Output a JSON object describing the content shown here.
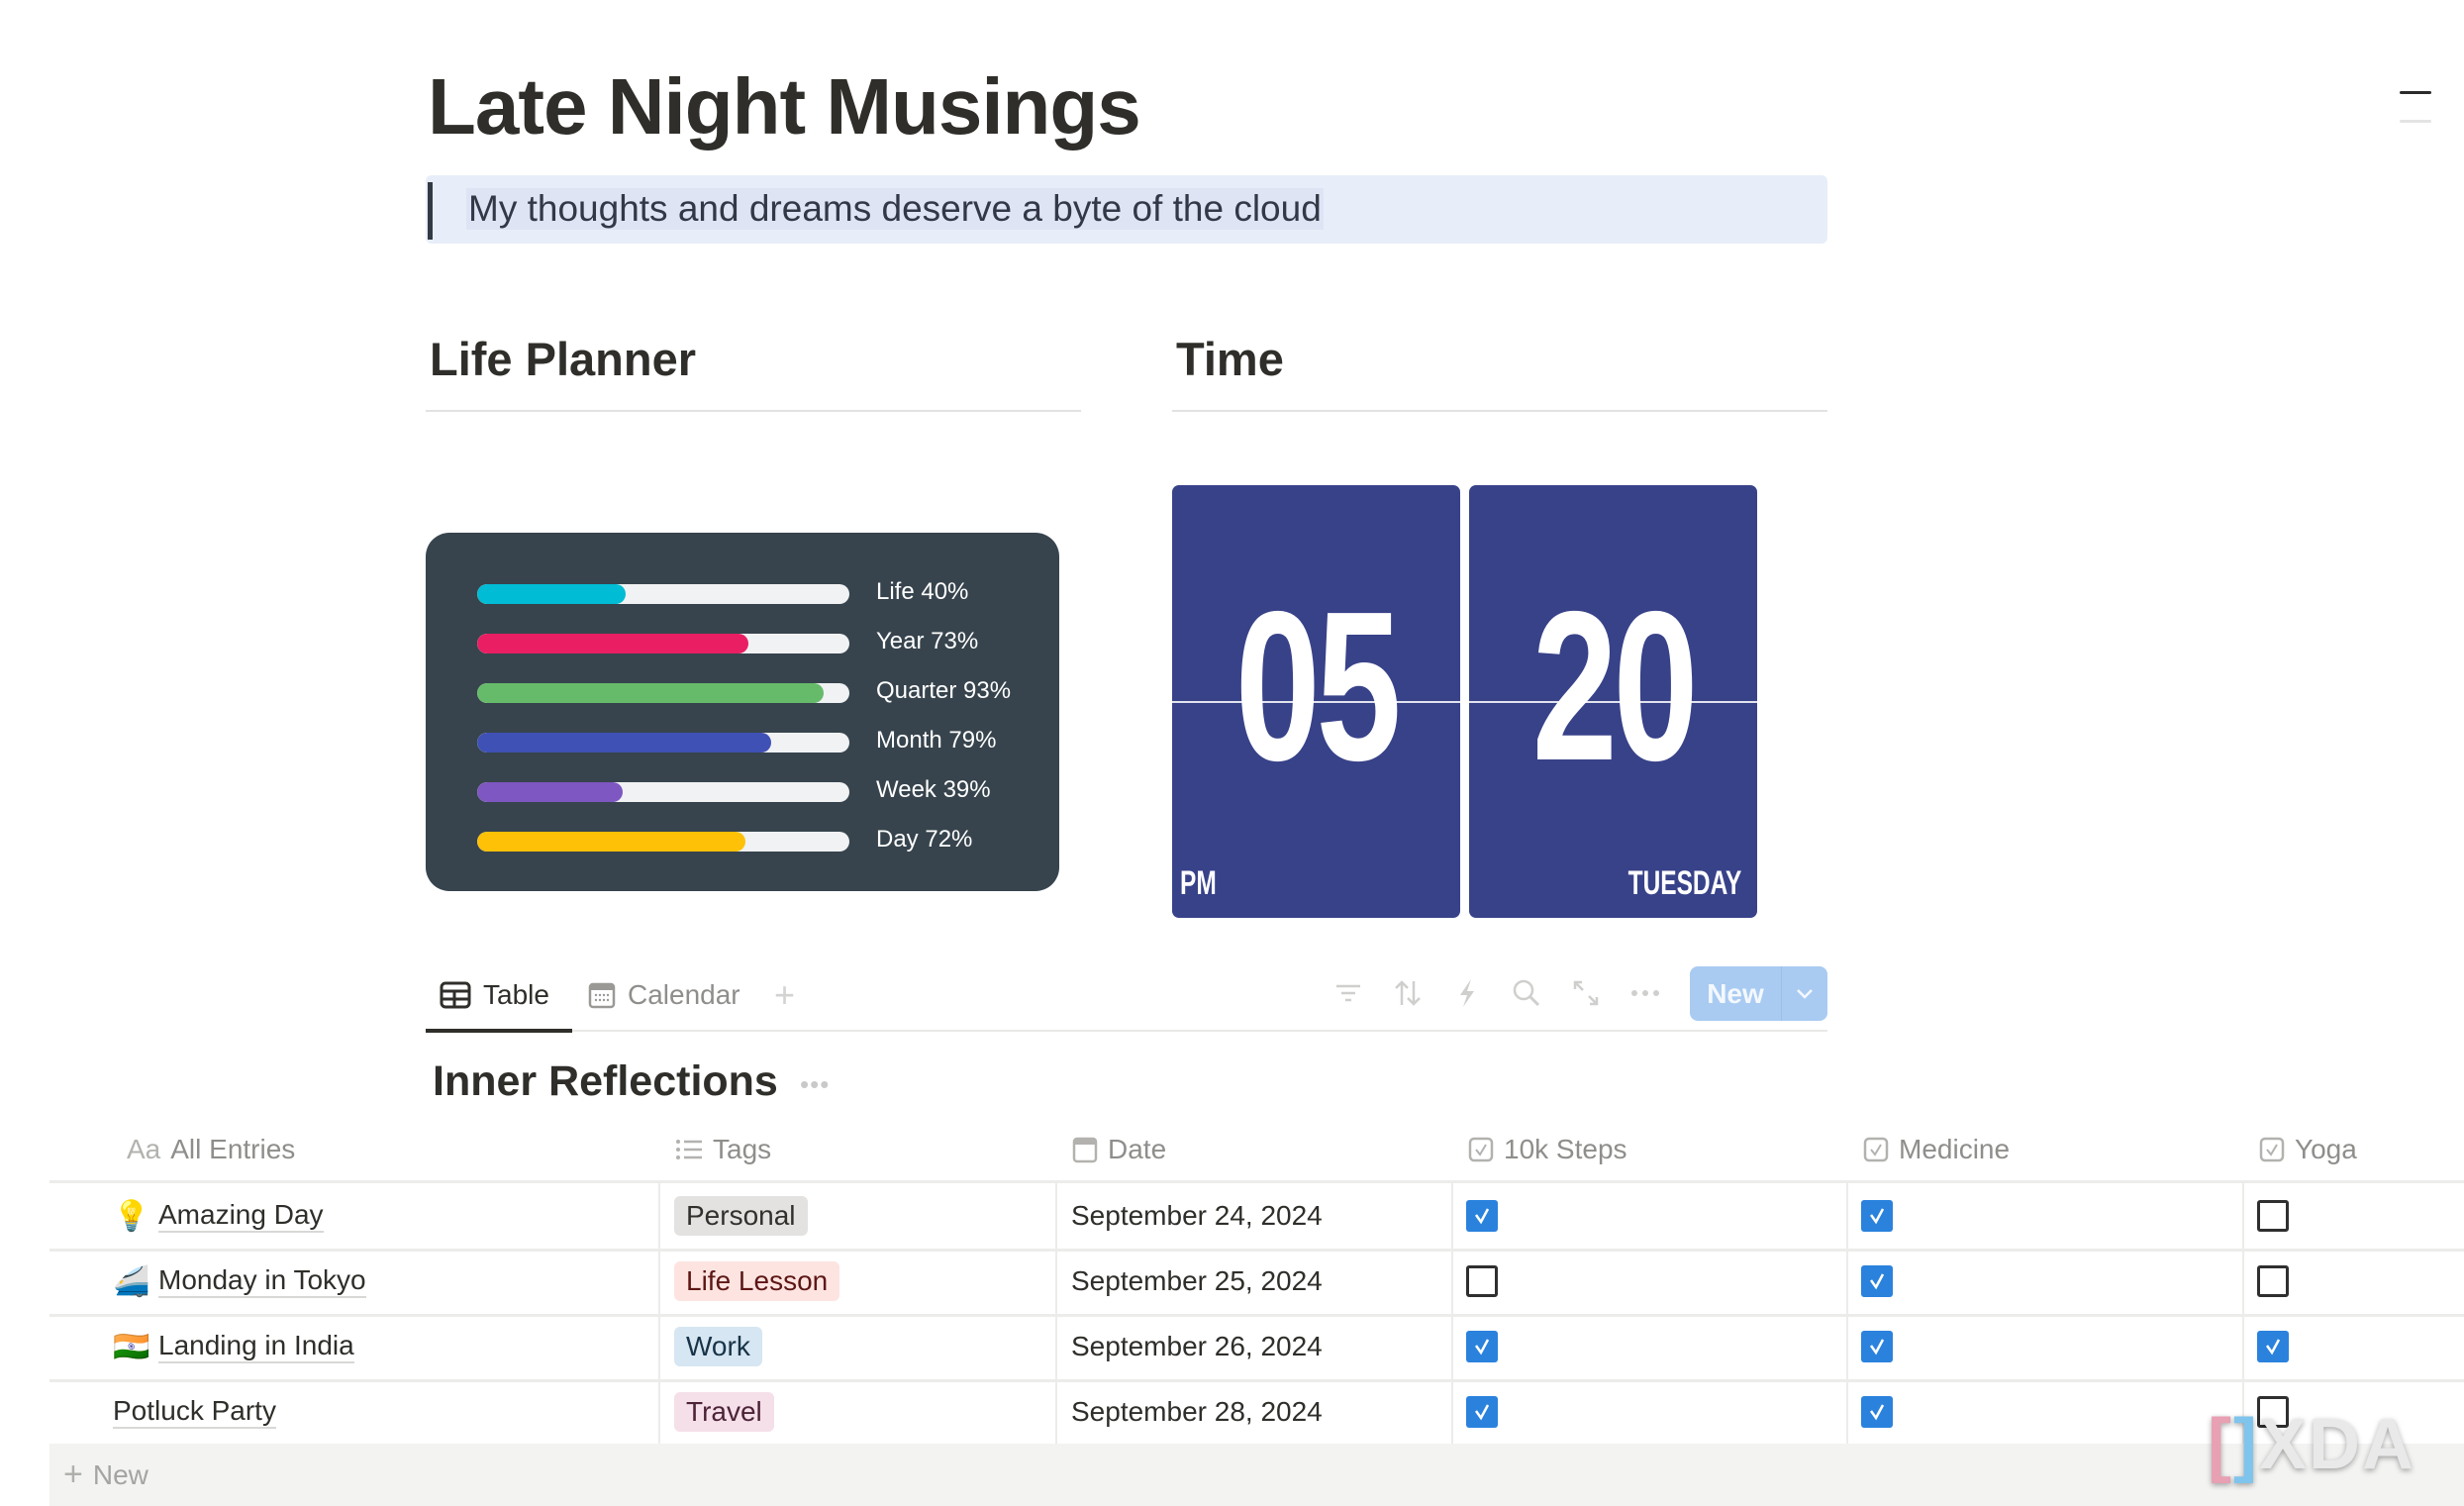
{
  "page": {
    "title": "Late Night Musings",
    "quote": "My thoughts and dreams deserve a byte of the cloud"
  },
  "columns": {
    "left_heading": "Life Planner",
    "right_heading": "Time"
  },
  "life_planner": {
    "bars": [
      {
        "label": "Life 40%",
        "percent": 40,
        "color": "#00bcd4"
      },
      {
        "label": "Year 73%",
        "percent": 73,
        "color": "#e91e63"
      },
      {
        "label": "Quarter 93%",
        "percent": 93,
        "color": "#66bb6a"
      },
      {
        "label": "Month 79%",
        "percent": 79,
        "color": "#3f51b5"
      },
      {
        "label": "Week 39%",
        "percent": 39,
        "color": "#7e57c2"
      },
      {
        "label": "Day 72%",
        "percent": 72,
        "color": "#ffc107"
      }
    ]
  },
  "clock": {
    "hours": "05",
    "minutes": "20",
    "meridiem": "PM",
    "weekday": "TUESDAY",
    "card_color": "#384289"
  },
  "views": {
    "tabs": [
      {
        "label": "Table",
        "icon": "table-icon",
        "active": true
      },
      {
        "label": "Calendar",
        "icon": "calendar-icon",
        "active": false
      }
    ],
    "add_view_icon": "plus-icon",
    "toolbar": [
      "filter-icon",
      "sort-icon",
      "automation-icon",
      "search-icon",
      "expand-icon",
      "more-icon"
    ],
    "new_button": "New"
  },
  "database": {
    "title": "Inner Reflections",
    "columns": [
      {
        "label": "All Entries",
        "icon": "title-icon"
      },
      {
        "label": "Tags",
        "icon": "list-icon"
      },
      {
        "label": "Date",
        "icon": "calendar-icon"
      },
      {
        "label": "10k Steps",
        "icon": "checkbox-icon"
      },
      {
        "label": "Medicine",
        "icon": "checkbox-icon"
      },
      {
        "label": "Yoga",
        "icon": "checkbox-icon"
      }
    ],
    "rows": [
      {
        "emoji": "💡",
        "name": "Amazing Day",
        "tag": "Personal",
        "tag_bg": "#e3e2e0",
        "tag_fg": "#32302c",
        "date": "September 24, 2024",
        "steps": true,
        "medicine": true,
        "yoga": false
      },
      {
        "emoji": "🚄",
        "name": "Monday in Tokyo",
        "tag": "Life Lesson",
        "tag_bg": "#fde4e1",
        "tag_fg": "#5d1715",
        "date": "September 25, 2024",
        "steps": false,
        "medicine": true,
        "yoga": false
      },
      {
        "emoji": "🇮🇳",
        "name": "Landing in India",
        "tag": "Work",
        "tag_bg": "#d6e6f2",
        "tag_fg": "#183347",
        "date": "September 26, 2024",
        "steps": true,
        "medicine": true,
        "yoga": true
      },
      {
        "emoji": "",
        "name": "Potluck Party",
        "tag": "Travel",
        "tag_bg": "#f5dfe9",
        "tag_fg": "#4c2337",
        "date": "September 28, 2024",
        "steps": true,
        "medicine": true,
        "yoga": false
      }
    ],
    "new_row_label": "New"
  },
  "watermark": "XDA"
}
